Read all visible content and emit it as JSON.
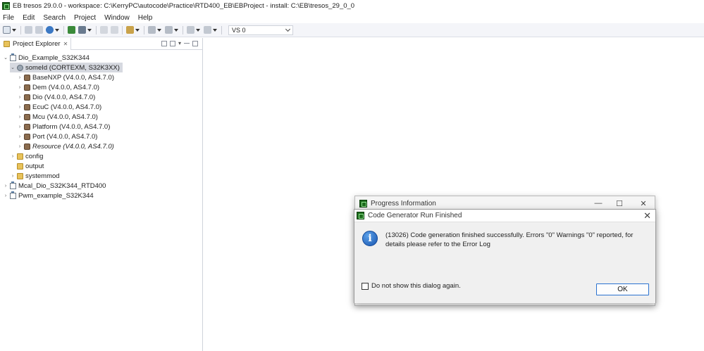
{
  "window": {
    "title": "EB tresos 29.0.0 - workspace: C:\\KerryPC\\autocode\\Practice\\RTD400_EB\\EBProject - install: C:\\EB\\tresos_29_0_0",
    "app_icon": "eb-tresos-icon"
  },
  "menu": [
    "File",
    "Edit",
    "Search",
    "Project",
    "Window",
    "Help"
  ],
  "toolbar": {
    "combo_value": "VS 0"
  },
  "explorer": {
    "tab_label": "Project Explorer",
    "tree": [
      {
        "label": "Dio_Example_S32K344",
        "level": 0,
        "twisty": "v",
        "icon": "project-icon"
      },
      {
        "label": "someId (CORTEXM, S32K3XX)",
        "level": 1,
        "twisty": "v",
        "icon": "config-icon",
        "selected": true
      },
      {
        "label": "BaseNXP (V4.0.0, AS4.7.0)",
        "level": 2,
        "twisty": ">",
        "icon": "module-icon"
      },
      {
        "label": "Dem (V4.0.0, AS4.7.0)",
        "level": 2,
        "twisty": ">",
        "icon": "module-icon"
      },
      {
        "label": "Dio (V4.0.0, AS4.7.0)",
        "level": 2,
        "twisty": ">",
        "icon": "module-icon"
      },
      {
        "label": "EcuC (V4.0.0, AS4.7.0)",
        "level": 2,
        "twisty": ">",
        "icon": "module-icon"
      },
      {
        "label": "Mcu (V4.0.0, AS4.7.0)",
        "level": 2,
        "twisty": ">",
        "icon": "module-icon"
      },
      {
        "label": "Platform (V4.0.0, AS4.7.0)",
        "level": 2,
        "twisty": ">",
        "icon": "module-icon"
      },
      {
        "label": "Port (V4.0.0, AS4.7.0)",
        "level": 2,
        "twisty": ">",
        "icon": "module-icon"
      },
      {
        "label": "Resource (V4.0.0, AS4.7.0)",
        "level": 2,
        "twisty": ">",
        "icon": "module-icon",
        "italic": true
      },
      {
        "label": "config",
        "level": 1,
        "twisty": ">",
        "icon": "folder-icon"
      },
      {
        "label": "output",
        "level": 1,
        "twisty": "",
        "icon": "folder-icon"
      },
      {
        "label": "systemmod",
        "level": 1,
        "twisty": ">",
        "icon": "folder-icon"
      },
      {
        "label": "Mcal_Dio_S32K344_RTD400",
        "level": 0,
        "twisty": ">",
        "icon": "project-icon"
      },
      {
        "label": "Pwm_example_S32K344",
        "level": 0,
        "twisty": ">",
        "icon": "project-icon"
      }
    ]
  },
  "progress_dialog": {
    "title": "Progress Information"
  },
  "codegen_dialog": {
    "title": "Code Generator Run Finished",
    "message": "(13026) Code generation finished successfully. Errors \"0\" Warnings \"0\" reported, for details please refer to the Error Log",
    "checkbox_label": "Do not show this dialog again.",
    "ok_label": "OK"
  }
}
